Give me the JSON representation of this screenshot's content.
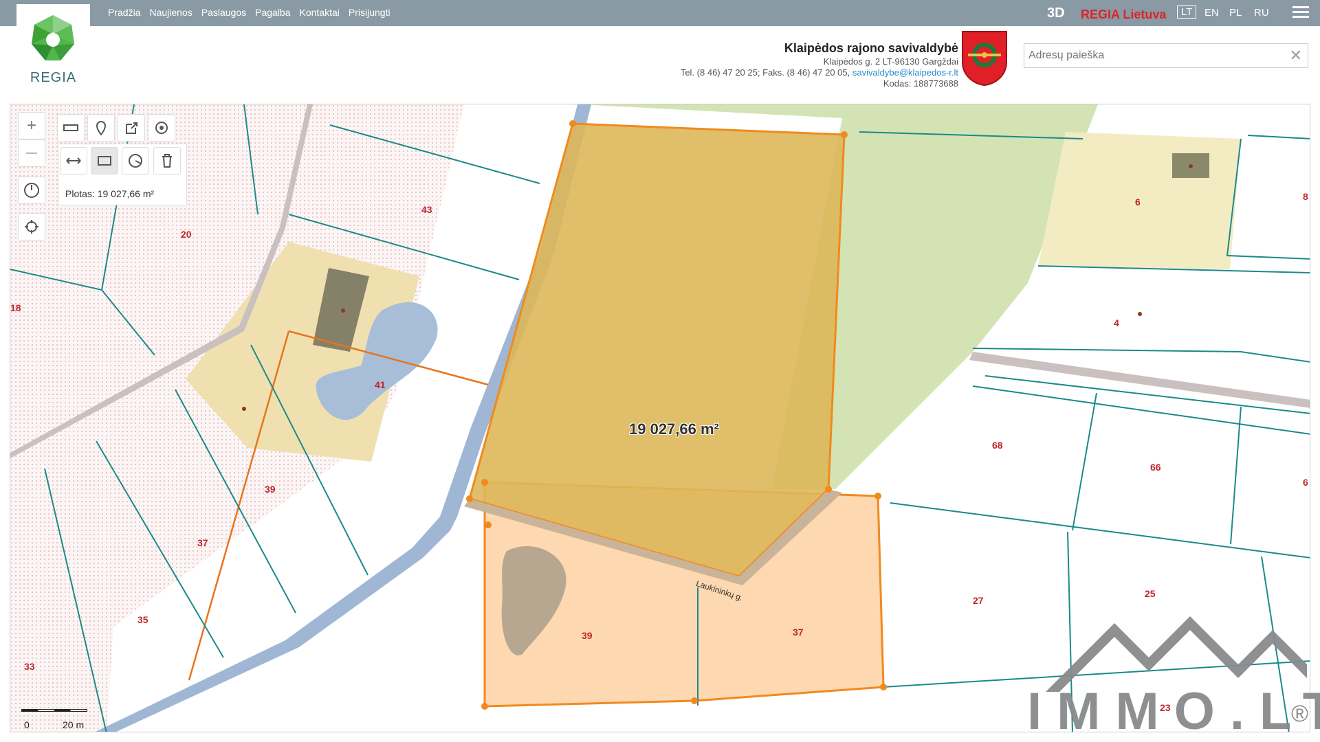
{
  "nav": {
    "items": [
      "Pradžia",
      "Naujienos",
      "Paslaugos",
      "Pagalba",
      "Kontaktai",
      "Prisijungti"
    ]
  },
  "logo": {
    "text": "REGIA"
  },
  "top_right": {
    "btn_3d": "3D",
    "regia_lietuva": "REGIA Lietuva",
    "languages": [
      "LT",
      "EN",
      "PL",
      "RU"
    ]
  },
  "municipality": {
    "name": "Klaipėdos rajono savivaldybė",
    "address": "Klaipėdos g. 2 LT-96130 Gargždai",
    "phone": "Tel. (8 46) 47 20 25; Faks. (8 46) 47 20 05,",
    "email": "savivaldybe@klaipedos-r.lt",
    "code": "Kodas: 188773688"
  },
  "search": {
    "placeholder": "Adresų paieška",
    "clear": "✕"
  },
  "tools": {
    "zoom_in": "+",
    "zoom_out": "—",
    "area_label": "Plotas: 19 027,66 m²"
  },
  "map": {
    "measured_area": "19 027,66 m²",
    "street": "Laukininkų g.",
    "parcels": [
      "43",
      "43",
      "20",
      "18",
      "41",
      "39",
      "37",
      "35",
      "33",
      "6",
      "8",
      "4",
      "68",
      "66",
      "6",
      "27",
      "25",
      "23",
      "39",
      "37"
    ],
    "scale": {
      "zero": "0",
      "dist": "20 m"
    }
  },
  "watermark": {
    "text": "IMMO.LT",
    "registered": "®"
  },
  "colors": {
    "topbar": "#8a9aa5",
    "parcel_line": "#1a8a8a",
    "measure": "#f08a1e",
    "parcel_label": "#c0262d"
  }
}
